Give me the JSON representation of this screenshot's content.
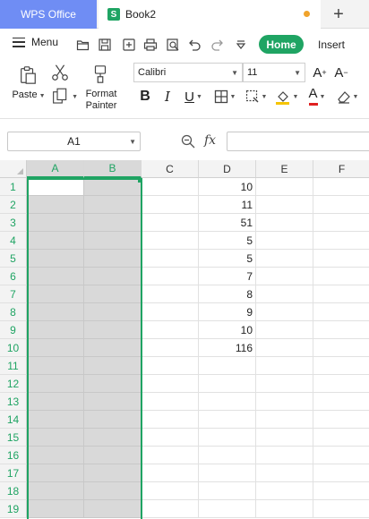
{
  "titlebar": {
    "app_tab": "WPS Office",
    "doc_tab": "Book2",
    "sheet_logo_letter": "S",
    "add_tab_label": "+"
  },
  "menubar": {
    "menu_label": "Menu",
    "quick_access_icons": [
      "open-icon",
      "save-icon",
      "export-icon",
      "print-icon",
      "print-preview-icon",
      "undo-icon",
      "redo-icon",
      "customize-icon"
    ],
    "tabs": {
      "home": "Home",
      "insert": "Insert"
    }
  },
  "ribbon": {
    "paste_label": "Paste",
    "format_painter_label_line1": "Format",
    "format_painter_label_line2": "Painter",
    "font_name": "Calibri",
    "font_size": "11",
    "increase_font": "A",
    "decrease_font": "A",
    "bold": "B",
    "italic": "I",
    "underline": "U",
    "font_color_letter": "A",
    "colors": {
      "fill": "#f5c400",
      "font": "#e02020",
      "accent": "#1fa463"
    }
  },
  "formula_bar": {
    "cell_ref": "A1",
    "fx_label": "fx",
    "formula": ""
  },
  "sheet": {
    "columns": [
      "A",
      "B",
      "C",
      "D",
      "E",
      "F"
    ],
    "rows": [
      "1",
      "2",
      "3",
      "4",
      "5",
      "6",
      "7",
      "8",
      "9",
      "10",
      "11",
      "12",
      "13",
      "14",
      "15",
      "16",
      "17",
      "18",
      "19"
    ],
    "selected_columns": [
      "A",
      "B"
    ],
    "active_cell": "A1",
    "column_d_values": [
      "10",
      "11",
      "51",
      "5",
      "5",
      "7",
      "8",
      "9",
      "10",
      "116"
    ]
  }
}
